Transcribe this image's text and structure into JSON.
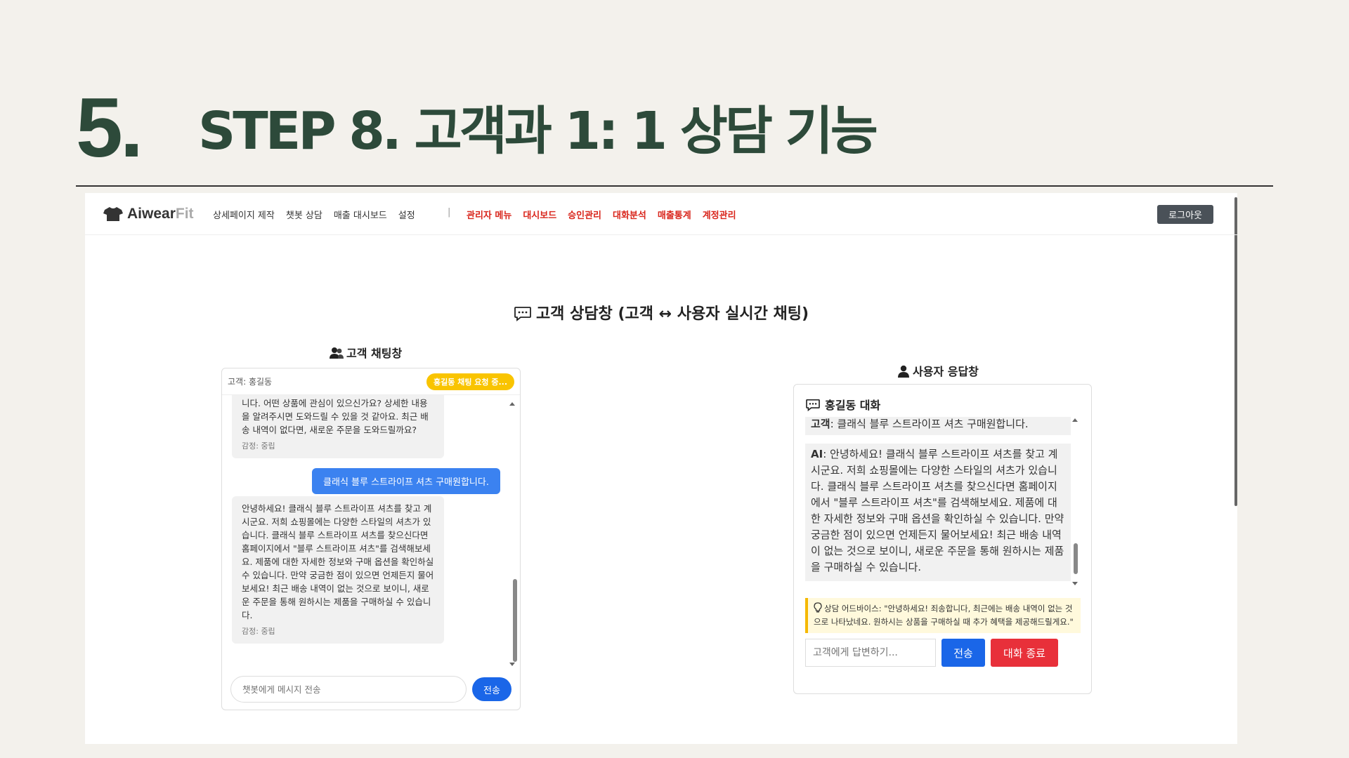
{
  "slide": {
    "number": "5.",
    "title": "STEP 8. 고객과 1: 1 상담 기능"
  },
  "navbar": {
    "brand_main": "Aiwear",
    "brand_accent": "Fit",
    "links": [
      "상세페이지 제작",
      "챗봇 상담",
      "매출 대시보드",
      "설정"
    ],
    "separator": "|",
    "admin_links": [
      "관리자 메뉴",
      "대시보드",
      "승인관리",
      "대화분석",
      "매출통계",
      "계정관리"
    ],
    "logout": "로그아웃"
  },
  "page": {
    "heading": "고객 상담창 (고객 ↔ 사용자 실시간 채팅)"
  },
  "customer_chat": {
    "title": "고객 채팅창",
    "customer_label": "고객: 홍길동",
    "badge": "홍길동 채팅 요청 중...",
    "messages": [
      {
        "role": "ai",
        "text": "니다. 어떤 상품에 관심이 있으신가요? 상세한 내용을 알려주시면 도와드릴 수 있을 것 같아요. 최근 배송 내역이 없다면, 새로운 주문을 도와드릴까요?",
        "emotion": "감정: 중립"
      },
      {
        "role": "user",
        "text": "클래식 블루 스트라이프 셔츠 구매원합니다."
      },
      {
        "role": "ai",
        "text": "안녕하세요! 클래식 블루 스트라이프 셔츠를 찾고 계시군요. 저희 쇼핑몰에는 다양한 스타일의 셔츠가 있습니다. 클래식 블루 스트라이프 셔츠를 찾으신다면 홈페이지에서 \"블루 스트라이프 셔츠\"를 검색해보세요. 제품에 대한 자세한 정보와 구매 옵션을 확인하실 수 있습니다. 만약 궁금한 점이 있으면 언제든지 물어보세요! 최근 배송 내역이 없는 것으로 보이니, 새로운 주문을 통해 원하시는 제품을 구매하실 수 있습니다.",
        "emotion": "감정: 중립"
      }
    ],
    "input_placeholder": "챗봇에게 메시지 전송",
    "send": "전송"
  },
  "user_panel": {
    "title": "사용자 응답창",
    "conversation_title": "홍길동 대화",
    "msg1_speaker": "고객",
    "msg1_text": ": 클래식 블루 스트라이프 셔츠 구매원합니다.",
    "msg2_speaker": "AI",
    "msg2_text": ": 안녕하세요! 클래식 블루 스트라이프 셔츠를 찾고 계시군요. 저희 쇼핑몰에는 다양한 스타일의 셔츠가 있습니다. 클래식 블루 스트라이프 셔츠를 찾으신다면 홈페이지에서 \"블루 스트라이프 셔츠\"를 검색해보세요. 제품에 대한 자세한 정보와 구매 옵션을 확인하실 수 있습니다. 만약 궁금한 점이 있으면 언제든지 물어보세요! 최근 배송 내역이 없는 것으로 보이니, 새로운 주문을 통해 원하시는 제품을 구매하실 수 있습니다.",
    "advice": "상담 어드바이스: \"안녕하세요! 죄송합니다, 최근에는 배송 내역이 없는 것으로 나타났네요. 원하시는 상품을 구매하실 때 추가 혜택을 제공해드릴게요.\"",
    "reply_placeholder": "고객에게 답변하기...",
    "send": "전송",
    "end": "대화 종료"
  },
  "colors": {
    "title_green": "#2d4a3a",
    "admin_red": "#d9261c",
    "primary_blue": "#1a66e8",
    "user_bubble_blue": "#3b82f0",
    "badge_yellow": "#f9c400",
    "end_red": "#e8303a",
    "advice_bg": "#fff9dc"
  },
  "icons": [
    "tshirt-icon",
    "chat-bubble-icon",
    "users-icon",
    "user-icon",
    "lightbulb-icon"
  ]
}
